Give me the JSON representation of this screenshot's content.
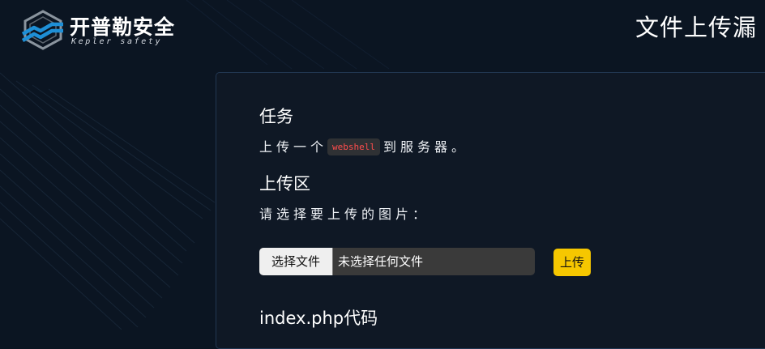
{
  "header": {
    "brand_cn": "开普勒安全",
    "brand_en": "Kepler safety",
    "page_title": "文件上传漏"
  },
  "task": {
    "heading": "任务",
    "text_before": "上传一个",
    "code": "webshell",
    "text_after": "到服务器。"
  },
  "upload": {
    "heading": "上传区",
    "instruction": "请选择要上传的图片：",
    "choose_button": "选择文件",
    "file_status": "未选择任何文件",
    "submit_button": "上传"
  },
  "code_section": {
    "heading": "index.php代码"
  },
  "colors": {
    "background": "#0b1522",
    "panel": "#0f1825",
    "accent_button": "#f6c700",
    "code_text": "#ff4d4d",
    "logo_blue": "#1e8fd6"
  },
  "icons": {
    "logo": "kepler-hexagon-logo-icon"
  }
}
